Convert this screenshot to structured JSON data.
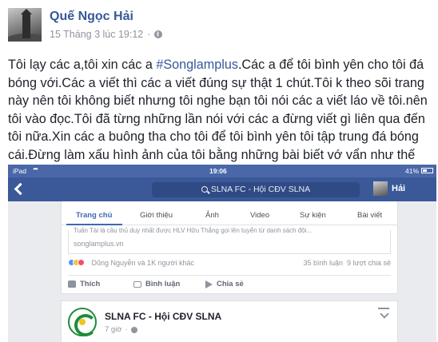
{
  "post": {
    "author": "Quế Ngọc Hải",
    "timestamp": "15 Tháng 3 lúc 19:12",
    "separator": "·",
    "privacy_icon": "globe-icon",
    "text_before_hashtag": "Tôi lạy các a,tôi xin các a ",
    "hashtag": "#Songlamplus",
    "text_after_hashtag": ".Các a để tôi bình yên cho tôi đá bóng với.Các a viết thì các a viết đúng sự thật 1 chút.Tôi k theo sõi trang này nên tôi không biết nhưng tôi nghe bạn tôi nói các a viết láo về tôi.nên tôi vào đọc.Tôi đã từng những lần nói với các a đừng viết gì liên qua đến tôi nữa.Xin các a buông tha cho tôi để tôi bình yên tôi tập trung đá bóng cái.Đừng làm xấu hình ảnh của tôi bằng những bài biết vớ vẩn như thế này.",
    "emoji": "smile-icon"
  },
  "screenshot": {
    "status": {
      "carrier": "iPad",
      "time": "19:06",
      "battery": "41%"
    },
    "nav": {
      "search_text": "SLNA FC - Hội CĐV SLNA",
      "user": "Hải"
    },
    "tabs": [
      "Trang chủ",
      "Giới thiệu",
      "Ảnh",
      "Video",
      "Sự kiện",
      "Bài viết"
    ],
    "active_tab": "Trang chủ",
    "card1": {
      "snippet": "Tuấn Tài là cầu thủ duy nhất được HLV Hữu Thắng gọi lên tuyển từ danh sách đội...",
      "link_domain": "songlamplus.vn",
      "reactions_text": "Dũng Nguyễn và 1K người khác",
      "comments": "35 bình luận",
      "shares": "9 lượt chia sẻ",
      "actions": [
        "Thích",
        "Bình luận",
        "Chia sẻ"
      ]
    },
    "card2": {
      "page_name": "SLNA FC - Hội CĐV SLNA",
      "time": "7 giờ",
      "separator": "·"
    }
  }
}
